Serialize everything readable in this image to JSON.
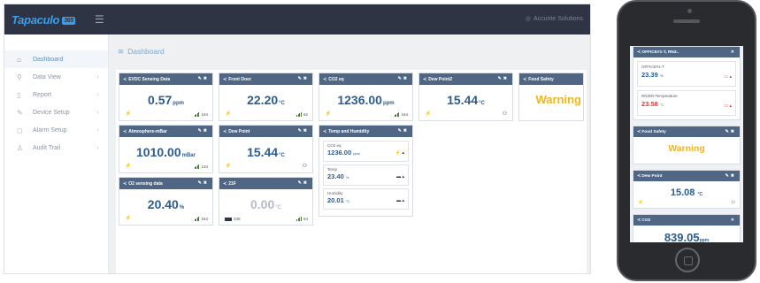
{
  "app": {
    "logo_text": "Tapaculo",
    "logo_badge": "365",
    "user_text": "Accurite Solutions"
  },
  "sidebar": {
    "items": [
      {
        "label": "Dashboard",
        "icon": "home-icon",
        "active": true
      },
      {
        "label": "Data View",
        "icon": "search-icon"
      },
      {
        "label": "Report",
        "icon": "document-icon"
      },
      {
        "label": "Device Setup",
        "icon": "wrench-icon"
      },
      {
        "label": "Alarm Setup",
        "icon": "bell-icon"
      },
      {
        "label": "Audit Trail",
        "icon": "user-icon"
      }
    ]
  },
  "page": {
    "title": "Dashboard"
  },
  "cards": [
    {
      "title": "EVDC Sensing Data",
      "value": "0.57",
      "unit": "ppm",
      "signal": "164"
    },
    {
      "title": "Front Door",
      "value": "22.20",
      "unit": "°C",
      "signal": "62"
    },
    {
      "title": "CO2 eq",
      "value": "1236.00",
      "unit": "ppm",
      "signal": "164"
    },
    {
      "title": "Dew Point2",
      "value": "15.44",
      "unit": "°C"
    },
    {
      "title": "Food Safety",
      "value": "Warning"
    },
    {
      "title": "Atmosphere-mBar",
      "value": "1010.00",
      "unit": "mBar",
      "signal": "134"
    },
    {
      "title": "Dew Point",
      "value": "15.44",
      "unit": "°C"
    },
    {
      "title": "O2 sensing data",
      "value": "20.40",
      "unit": "%",
      "signal": "164"
    },
    {
      "title": "21F",
      "value": "0.00",
      "unit": "°C",
      "battery": "235",
      "signal": "64"
    }
  ],
  "multi_card": {
    "title": "Temp and Humidity",
    "items": [
      {
        "label": "CO2 eq",
        "value": "1236.00",
        "unit": "ppm"
      },
      {
        "label": "Temp",
        "value": "23.40",
        "unit": "%"
      },
      {
        "label": "Humidity",
        "value": "20.01",
        "unit": "°C"
      }
    ]
  },
  "phone": {
    "office_card": {
      "title": "OFFICE#1-T, RN3..",
      "items": [
        {
          "label": "OFFICE#1-T",
          "value": "23.39",
          "unit": "%",
          "color": "#2d5d8e"
        },
        {
          "label": "RN300-Temperature",
          "value": "23.58",
          "unit": "°C",
          "color": "#d9383a"
        }
      ]
    },
    "food_card": {
      "title": "Food Safety",
      "value": "Warning"
    },
    "dew_card": {
      "title": "Dew Point",
      "value": "15.08",
      "unit": "°C"
    },
    "co2_card": {
      "title": "CO2",
      "value": "839.05",
      "unit": "ppm"
    }
  },
  "colors": {
    "header": "#4f6685",
    "value": "#2d5d8e",
    "warning": "#f2b51b",
    "topbar": "#2e3443"
  }
}
